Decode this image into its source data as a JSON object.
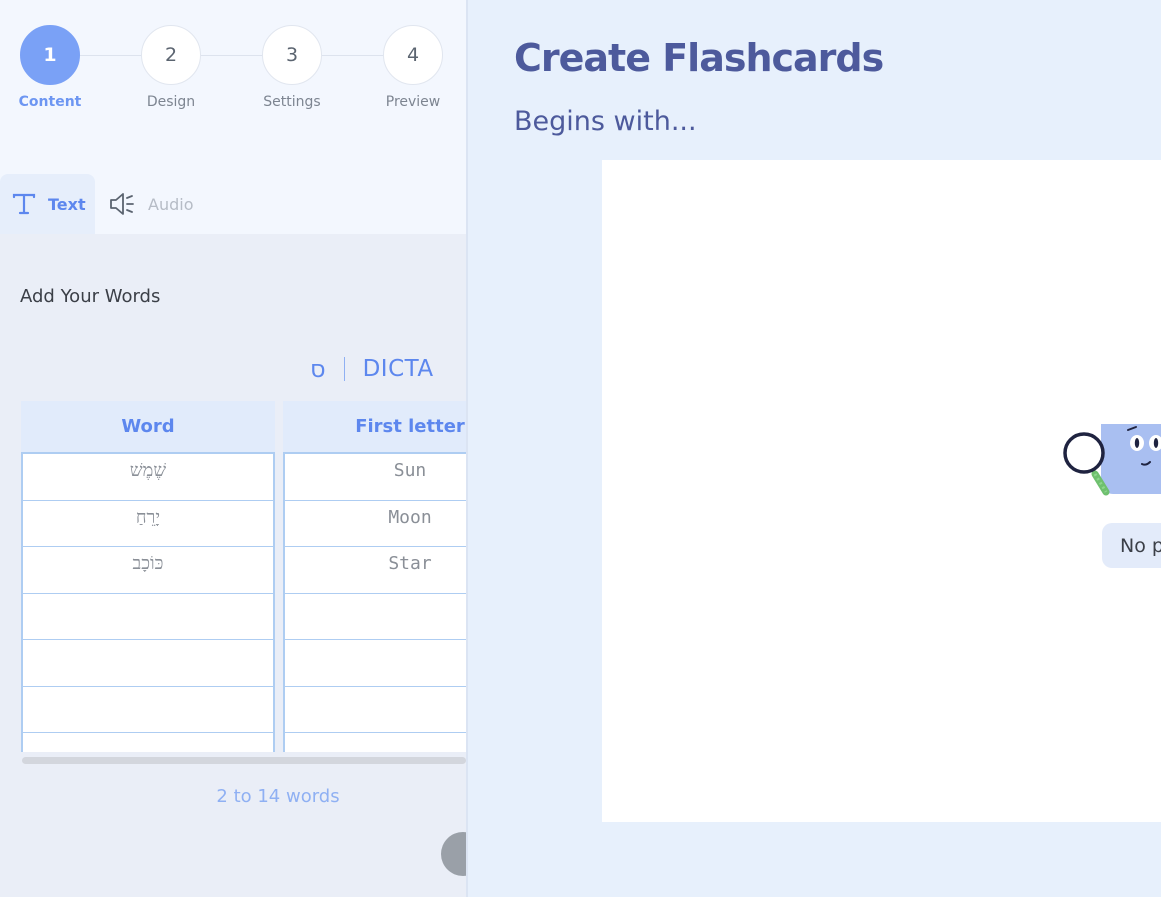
{
  "steps": [
    {
      "number": "1",
      "label": "Content",
      "active": true
    },
    {
      "number": "2",
      "label": "Design",
      "active": false
    },
    {
      "number": "3",
      "label": "Settings",
      "active": false
    },
    {
      "number": "4",
      "label": "Preview",
      "active": false
    }
  ],
  "tabs": [
    {
      "label": "Text",
      "icon": "text-icon",
      "active": true
    },
    {
      "label": "Audio",
      "icon": "speaker-icon",
      "active": false
    }
  ],
  "content": {
    "section_title": "Add Your Words",
    "dicta_logo_symbol": "ס",
    "dicta_label": "DICTA",
    "table": {
      "columns": [
        "Word",
        "First letter"
      ],
      "rows": [
        [
          "שֶׁמֶשׁ",
          "Sun"
        ],
        [
          "יָרֵחַ",
          "Moon"
        ],
        [
          "כּוֹכָב",
          "Star"
        ],
        [
          "",
          ""
        ],
        [
          "",
          ""
        ],
        [
          "",
          ""
        ],
        [
          "",
          ""
        ]
      ]
    },
    "word_count_hint": "2 to 14 words"
  },
  "preview": {
    "title": "Create Flashcards",
    "subtitle": "Begins with...",
    "empty_message": "No p"
  },
  "colors": {
    "accent": "#5d87ee",
    "step_active": "#7aa1f6",
    "title": "#4d5a9c"
  }
}
